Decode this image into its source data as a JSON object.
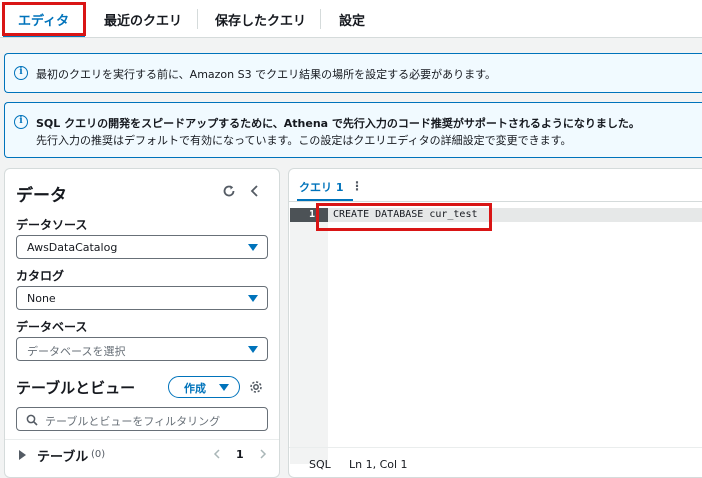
{
  "tabs": [
    {
      "label": "エディタ",
      "active": true
    },
    {
      "label": "最近のクエリ"
    },
    {
      "label": "保存したクエリ"
    },
    {
      "label": "設定"
    }
  ],
  "alerts": {
    "s3_notice": "最初のクエリを実行する前に、Amazon S3 でクエリ結果の場所を設定する必要があります。",
    "autocomplete_title": "SQL クエリの開発をスピードアップするために、Athena で先行入力のコード推奨がサポートされるようになりました。",
    "autocomplete_body": "先行入力の推奨はデフォルトで有効になっています。この設定はクエリエディタの詳細設定で変更できます。"
  },
  "data_panel": {
    "title": "データ",
    "datasource_label": "データソース",
    "datasource_value": "AwsDataCatalog",
    "catalog_label": "カタログ",
    "catalog_value": "None",
    "database_label": "データベース",
    "database_placeholder": "データベースを選択",
    "tables_views_title": "テーブルとビュー",
    "create_label": "作成",
    "filter_placeholder": "テーブルとビューをフィルタリング",
    "tables_label": "テーブル",
    "tables_count": "(0)",
    "page_number": "1"
  },
  "editor": {
    "tab_label": "クエリ 1",
    "line_number": "1",
    "code_line": "CREATE DATABASE cur_test",
    "status_language": "SQL",
    "status_position": "Ln 1, Col 1"
  },
  "colors": {
    "accent": "#0073bb",
    "highlight_box": "#d91515",
    "info_background": "#f1faff"
  }
}
